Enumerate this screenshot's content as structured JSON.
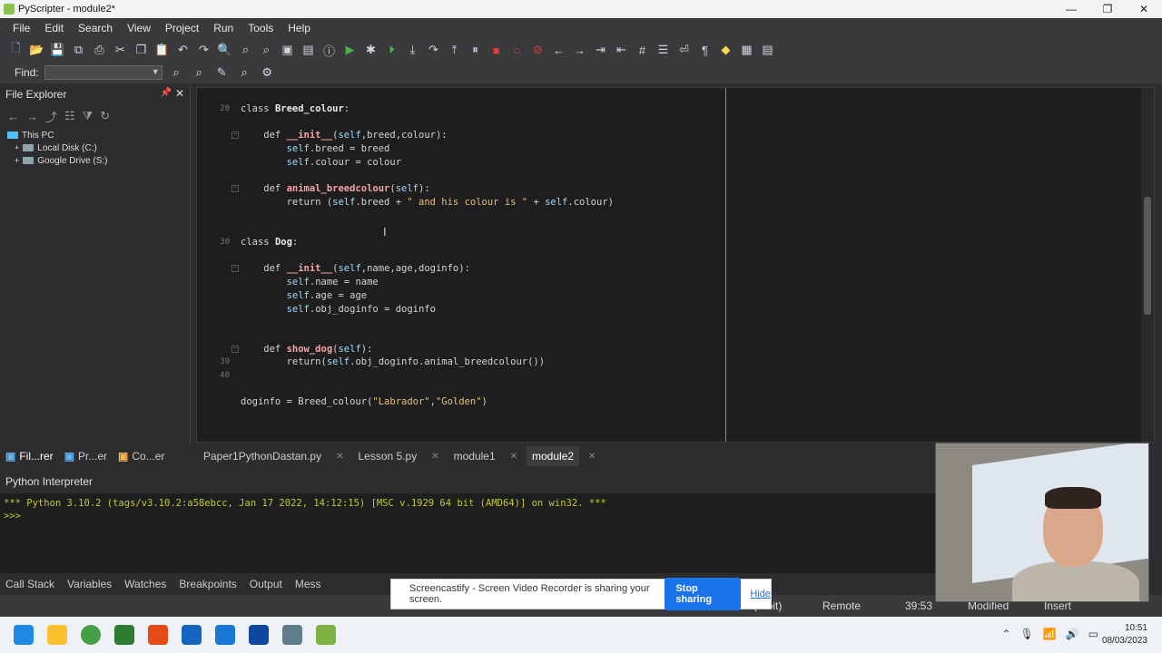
{
  "window": {
    "title": "PyScripter - module2*"
  },
  "menu": [
    "File",
    "Edit",
    "Search",
    "View",
    "Project",
    "Run",
    "Tools",
    "Help"
  ],
  "find": {
    "label": "Find:"
  },
  "file_explorer": {
    "title": "File Explorer",
    "tree": [
      {
        "label": "This PC",
        "kind": "pc"
      },
      {
        "label": "Local Disk (C:)",
        "kind": "drive"
      },
      {
        "label": "Google Drive (S:)",
        "kind": "drive"
      }
    ]
  },
  "editor": {
    "line_numbers": [
      {
        "n": "20",
        "row": 0
      },
      {
        "n": "30",
        "row": 10
      },
      {
        "n": "39",
        "row": 19
      },
      {
        "n": "40",
        "row": 20
      }
    ],
    "lines": [
      "class Breed_colour:",
      "",
      "    def __init__(self,breed,colour):",
      "        self.breed = breed",
      "        self.colour = colour",
      "",
      "    def animal_breedcolour(self):",
      "        return (self.breed + \" and his colour is \" + self.colour)",
      "",
      "",
      "class Dog:",
      "",
      "    def __init__(self,name,age,doginfo):",
      "        self.name = name",
      "        self.age = age",
      "        self.obj_doginfo = doginfo",
      "",
      "",
      "    def show_dog(self):",
      "        return(self.obj_doginfo.animal_breedcolour())",
      "",
      "",
      "doginfo = Breed_colour(\"Labrador\",\"Golden\")"
    ]
  },
  "left_tabs": [
    "Fil...rer",
    "Pr...er",
    "Co...er"
  ],
  "file_tabs": [
    {
      "label": "Paper1PythonDastan.py",
      "active": false
    },
    {
      "label": "Lesson 5.py",
      "active": false
    },
    {
      "label": "module1",
      "active": false
    },
    {
      "label": "module2",
      "active": true
    }
  ],
  "interpreter": {
    "title": "Python Interpreter",
    "banner": "*** Python 3.10.2 (tags/v3.10.2:a58ebcc, Jan 17 2022, 14:12:15) [MSC v.1929 64 bit (AMD64)] on win32. ***",
    "prompt": ">>>"
  },
  "bottom_tabs": [
    "Call Stack",
    "Variables",
    "Watches",
    "Breakpoints",
    "Output",
    "Mess"
  ],
  "status": {
    "bits": "(4-bit)",
    "remote": "Remote",
    "position": "39:53",
    "modified": "Modified",
    "mode": "Insert"
  },
  "share_bar": {
    "message": "Screencastify - Screen Video Recorder is sharing your screen.",
    "stop": "Stop sharing",
    "hide": "Hide"
  },
  "taskbar": {
    "time": "10:51",
    "date": "08/03/2023"
  }
}
